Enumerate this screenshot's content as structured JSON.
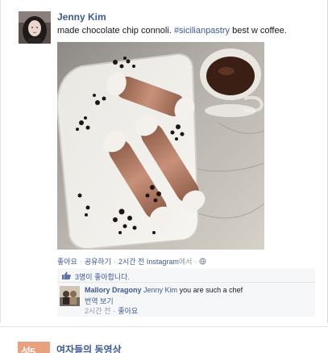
{
  "post": {
    "author": "Jenny Kim",
    "caption_before": "made chocolate chip connoli. ",
    "hashtag": "#sicilianpastry",
    "caption_after": " best w coffee.",
    "actions": {
      "like": "좋아요",
      "share": "공유하기",
      "time": "2시간 전",
      "via_prefix": "Instagram",
      "via_suffix": "에서",
      "separator": "·"
    },
    "likes": {
      "text": "3명이 좋아합니다."
    },
    "comments": [
      {
        "author": "Mallory Dragony",
        "mention": "Jenny Kim",
        "text": " you are such a chef",
        "translate": "번역 보기",
        "time": "2시간 전",
        "like": "좋아요",
        "separator": "·"
      }
    ]
  },
  "next_story": {
    "page_name": "여자들의 동영상",
    "icon_text": "성5"
  }
}
